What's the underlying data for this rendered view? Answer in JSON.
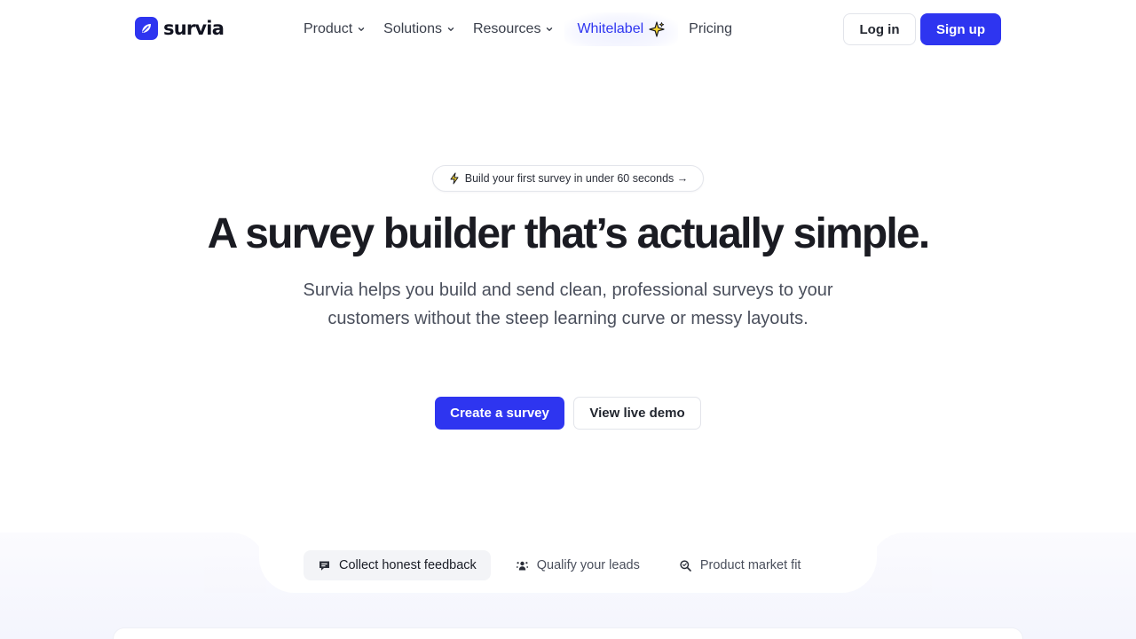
{
  "brand": {
    "name": "survia",
    "color": "#2e35f0"
  },
  "nav": {
    "items": [
      {
        "label": "Product",
        "dropdown": true
      },
      {
        "label": "Solutions",
        "dropdown": true
      },
      {
        "label": "Resources",
        "dropdown": true
      },
      {
        "label": "Whitelabel",
        "icon": "sparkle-icon"
      },
      {
        "label": "Pricing"
      }
    ]
  },
  "header": {
    "login_label": "Log in",
    "signup_label": "Sign up"
  },
  "hero": {
    "pill_text": "Build your first survey in under 60 seconds →",
    "pill_icon": "lightning-icon",
    "title": "A survey builder that’s actually simple.",
    "subtitle": "Survia helps you build and send clean, professional surveys to your customers without the steep learning curve or messy layouts.",
    "primary_cta": "Create a survey",
    "secondary_cta": "View live demo"
  },
  "showcase": {
    "tabs": [
      {
        "label": "Collect honest feedback",
        "icon": "feedback-icon",
        "active": true
      },
      {
        "label": "Qualify your leads",
        "icon": "leads-icon",
        "active": false
      },
      {
        "label": "Product market fit",
        "icon": "search-icon",
        "active": false
      }
    ]
  }
}
